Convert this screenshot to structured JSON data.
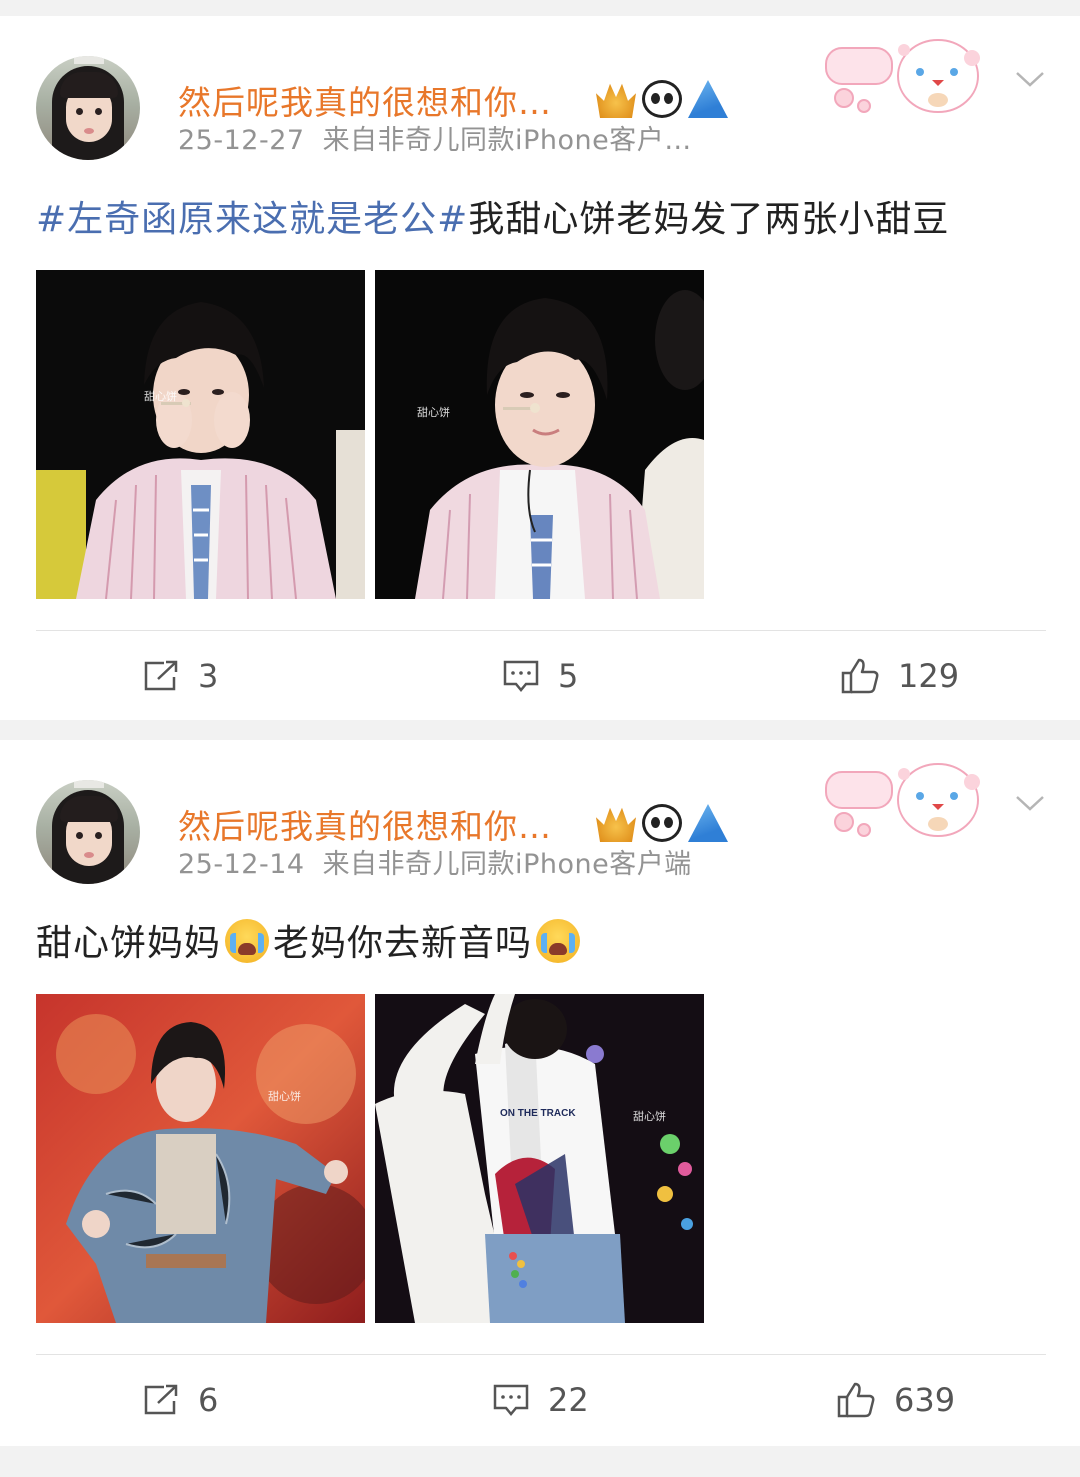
{
  "posts": [
    {
      "username": "然后呢我真的很想和你…",
      "date": "25-12-27",
      "source": "来自非奇儿同款iPhone客户…",
      "text_tag": "#左奇函原来这就是老公#",
      "text_main": "我甜心饼老妈发了两张小甜豆",
      "text_segments": [],
      "actions": {
        "share_count": "3",
        "comment_count": "5",
        "like_count": "129"
      },
      "photos": [
        "stage-photo-hands-on-cheeks",
        "stage-photo-smiling"
      ]
    },
    {
      "username": "然后呢我真的很想和你…",
      "date": "25-12-14",
      "source": "来自非奇儿同款iPhone客户端",
      "text_tag": "",
      "text_part1": "甜心饼妈妈",
      "text_part2": "老妈你去新音吗",
      "actions": {
        "share_count": "6",
        "comment_count": "22",
        "like_count": "639"
      },
      "photos": [
        "stage-photo-denim-jacket",
        "stage-photo-on-the-track"
      ]
    }
  ],
  "photo_text": {
    "jersey_print": "ON THE TRACK"
  },
  "colors": {
    "username": "#e8772a",
    "tag": "#4a6eb0",
    "meta": "#939393",
    "background": "#f2f2f2"
  },
  "icons": [
    "crown-badge-icon",
    "panda-badge-icon",
    "shark-badge-icon",
    "chevron-down-icon",
    "share-icon",
    "comment-icon",
    "like-icon",
    "crying-emoji-icon"
  ]
}
